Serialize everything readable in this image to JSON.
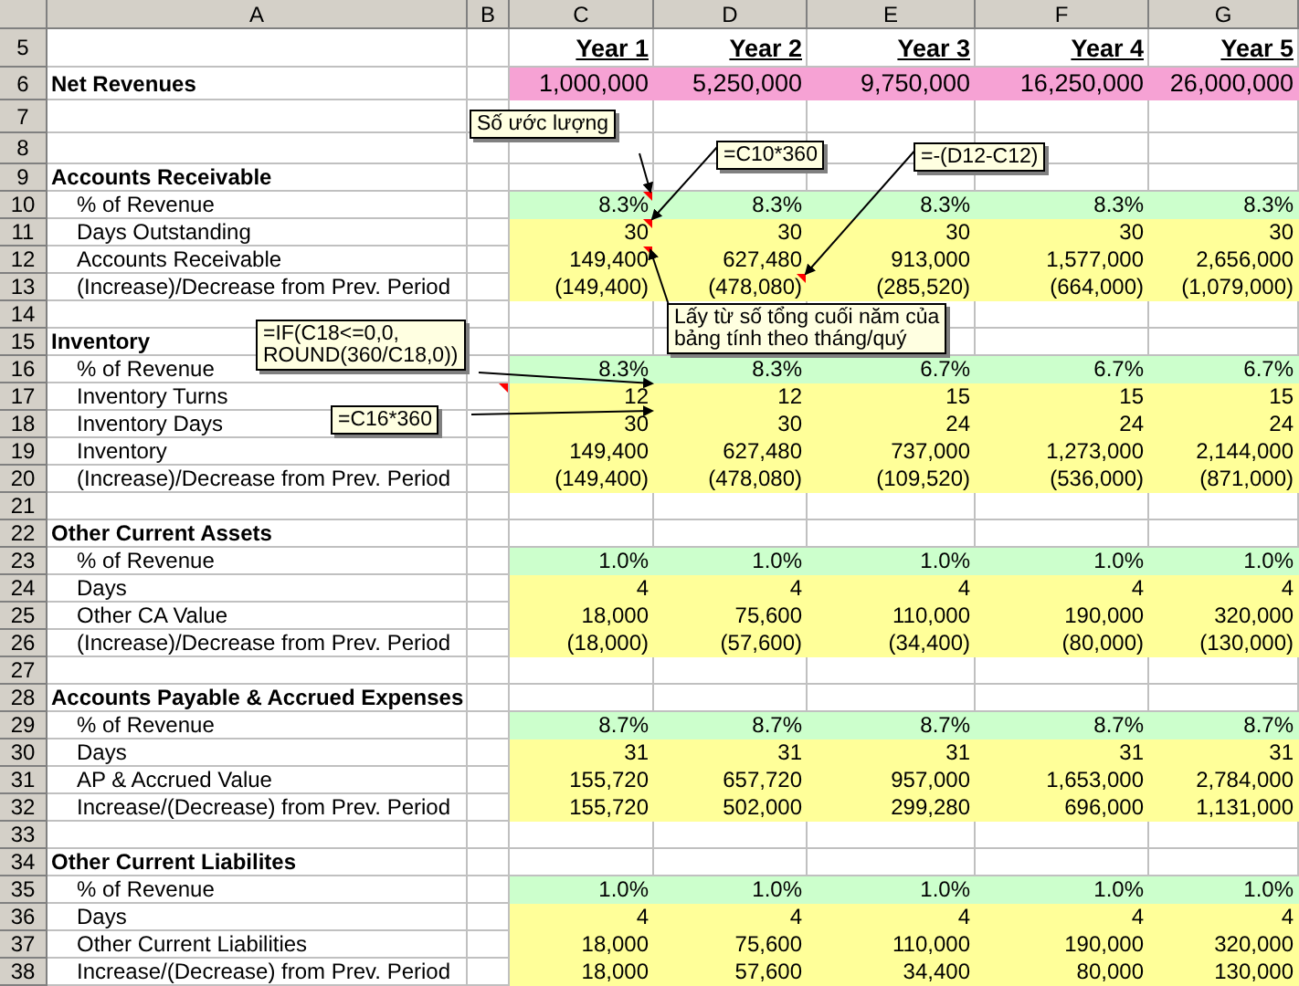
{
  "columns": [
    "A",
    "B",
    "C",
    "D",
    "E",
    "F",
    "G"
  ],
  "rows": [
    {
      "number": "5",
      "kind": "years",
      "values": [
        "Year 1",
        "Year 2",
        "Year 3",
        "Year 4",
        "Year 5"
      ]
    },
    {
      "number": "6",
      "kind": "revenue",
      "label": "Net Revenues",
      "values": [
        "1,000,000",
        "5,250,000",
        "9,750,000",
        "16,250,000",
        "26,000,000"
      ]
    },
    {
      "number": "7",
      "kind": "blank"
    },
    {
      "number": "8",
      "kind": "blank"
    },
    {
      "number": "9",
      "kind": "section",
      "label": "Accounts Receivable"
    },
    {
      "number": "10",
      "kind": "percent",
      "label": "% of Revenue",
      "values": [
        "8.3%",
        "8.3%",
        "8.3%",
        "8.3%",
        "8.3%"
      ],
      "note_marks": [
        false,
        false,
        true,
        false,
        false,
        false,
        false
      ]
    },
    {
      "number": "11",
      "kind": "value",
      "label": "Days Outstanding",
      "values": [
        "30",
        "30",
        "30",
        "30",
        "30"
      ],
      "note_marks": [
        false,
        false,
        true,
        false,
        false,
        false,
        false
      ]
    },
    {
      "number": "12",
      "kind": "value",
      "label": "Accounts Receivable",
      "values": [
        "149,400",
        "627,480",
        "913,000",
        "1,577,000",
        "2,656,000"
      ],
      "note_marks": [
        false,
        false,
        true,
        false,
        false,
        false,
        false
      ]
    },
    {
      "number": "13",
      "kind": "value",
      "label": "(Increase)/Decrease from Prev. Period",
      "values": [
        "(149,400)",
        "(478,080)",
        "(285,520)",
        "(664,000)",
        "(1,079,000)"
      ],
      "note_marks": [
        false,
        false,
        false,
        true,
        false,
        false,
        false
      ]
    },
    {
      "number": "14",
      "kind": "gap"
    },
    {
      "number": "15",
      "kind": "section",
      "label": "Inventory"
    },
    {
      "number": "16",
      "kind": "percent",
      "label": "% of Revenue",
      "values": [
        "8.3%",
        "8.3%",
        "6.7%",
        "6.7%",
        "6.7%"
      ]
    },
    {
      "number": "17",
      "kind": "value",
      "label": "Inventory Turns",
      "values": [
        "12",
        "12",
        "15",
        "15",
        "15"
      ],
      "note_marks": [
        false,
        true,
        false,
        false,
        false,
        false,
        false
      ]
    },
    {
      "number": "18",
      "kind": "value",
      "label": "Inventory Days",
      "values": [
        "30",
        "30",
        "24",
        "24",
        "24"
      ]
    },
    {
      "number": "19",
      "kind": "value",
      "label": "Inventory",
      "values": [
        "149,400",
        "627,480",
        "737,000",
        "1,273,000",
        "2,144,000"
      ]
    },
    {
      "number": "20",
      "kind": "value",
      "label": "(Increase)/Decrease from Prev. Period",
      "values": [
        "(149,400)",
        "(478,080)",
        "(109,520)",
        "(536,000)",
        "(871,000)"
      ]
    },
    {
      "number": "21",
      "kind": "gap"
    },
    {
      "number": "22",
      "kind": "section",
      "label": "Other Current Assets"
    },
    {
      "number": "23",
      "kind": "percent",
      "label": "% of Revenue",
      "values": [
        "1.0%",
        "1.0%",
        "1.0%",
        "1.0%",
        "1.0%"
      ]
    },
    {
      "number": "24",
      "kind": "value",
      "label": "Days",
      "values": [
        "4",
        "4",
        "4",
        "4",
        "4"
      ]
    },
    {
      "number": "25",
      "kind": "value",
      "label": "Other CA Value",
      "values": [
        "18,000",
        "75,600",
        "110,000",
        "190,000",
        "320,000"
      ]
    },
    {
      "number": "26",
      "kind": "value",
      "label": "(Increase)/Decrease from Prev. Period",
      "values": [
        "(18,000)",
        "(57,600)",
        "(34,400)",
        "(80,000)",
        "(130,000)"
      ]
    },
    {
      "number": "27",
      "kind": "gap"
    },
    {
      "number": "28",
      "kind": "section",
      "label": "Accounts Payable & Accrued Expenses"
    },
    {
      "number": "29",
      "kind": "percent",
      "label": "% of Revenue",
      "values": [
        "8.7%",
        "8.7%",
        "8.7%",
        "8.7%",
        "8.7%"
      ]
    },
    {
      "number": "30",
      "kind": "value",
      "label": "Days",
      "values": [
        "31",
        "31",
        "31",
        "31",
        "31"
      ]
    },
    {
      "number": "31",
      "kind": "value",
      "label": "AP & Accrued Value",
      "values": [
        "155,720",
        "657,720",
        "957,000",
        "1,653,000",
        "2,784,000"
      ]
    },
    {
      "number": "32",
      "kind": "value",
      "label": "Increase/(Decrease) from Prev. Period",
      "values": [
        "155,720",
        "502,000",
        "299,280",
        "696,000",
        "1,131,000"
      ]
    },
    {
      "number": "33",
      "kind": "gap"
    },
    {
      "number": "34",
      "kind": "section",
      "label": "Other Current Liabilites"
    },
    {
      "number": "35",
      "kind": "percent",
      "label": "% of Revenue",
      "values": [
        "1.0%",
        "1.0%",
        "1.0%",
        "1.0%",
        "1.0%"
      ]
    },
    {
      "number": "36",
      "kind": "value",
      "label": "Days",
      "values": [
        "4",
        "4",
        "4",
        "4",
        "4"
      ]
    },
    {
      "number": "37",
      "kind": "value",
      "label": "Other Current Liabilities",
      "values": [
        "18,000",
        "75,600",
        "110,000",
        "190,000",
        "320,000"
      ]
    },
    {
      "number": "38",
      "kind": "value",
      "label": "Increase/(Decrease) from Prev. Period",
      "values": [
        "18,000",
        "57,600",
        "34,400",
        "80,000",
        "130,000"
      ]
    }
  ],
  "comments": [
    {
      "text": "Số ước lượng"
    },
    {
      "text": "=C10*360"
    },
    {
      "text": "=-(D12-C12)"
    },
    {
      "text": "Lấy từ số tổng cuối năm của\nbảng tính theo tháng/quý"
    },
    {
      "text": "=IF(C18<=0,0,\nROUND(360/C18,0))"
    },
    {
      "text": "=C16*360"
    }
  ]
}
